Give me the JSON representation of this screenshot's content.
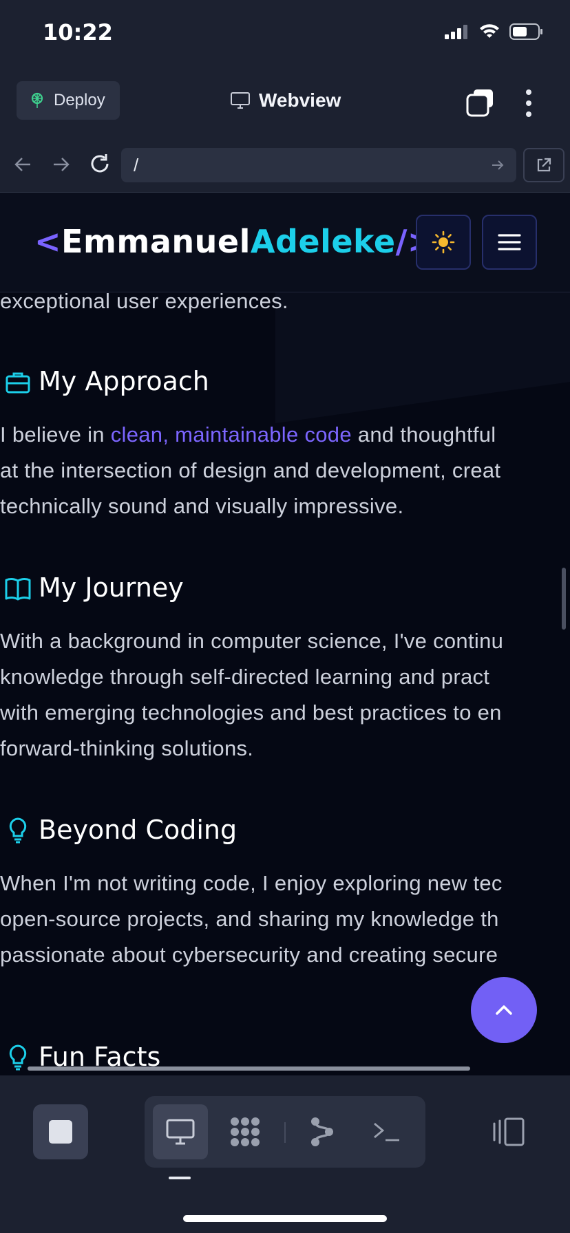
{
  "status_bar": {
    "time": "10:22"
  },
  "replit_topbar": {
    "deploy_label": "Deploy",
    "title": "Webview"
  },
  "url_bar": {
    "value": "/"
  },
  "site": {
    "logo": {
      "open": "<",
      "first_name": "Emmanuel",
      "last_name": "Adeleke",
      "close": "/>"
    }
  },
  "content": {
    "intro_tail": "exceptional user experiences.",
    "sections": [
      {
        "title": "My Approach",
        "icon": "briefcase-icon",
        "lines": [
          {
            "pre": "I believe in ",
            "hl": "clean, maintainable code",
            "post": " and thoughtful"
          },
          {
            "pre": "at the intersection of design and development, creat"
          },
          {
            "pre": "technically sound and visually impressive."
          }
        ]
      },
      {
        "title": "My Journey",
        "icon": "book-icon",
        "lines": [
          {
            "pre": "With a background in computer science, I've continu"
          },
          {
            "pre": "knowledge through self-directed learning and pract"
          },
          {
            "pre": "with emerging technologies and best practices to en"
          },
          {
            "pre": "forward-thinking solutions."
          }
        ]
      },
      {
        "title": "Beyond Coding",
        "icon": "lightbulb-icon",
        "lines": [
          {
            "pre": "When I'm not writing code, I enjoy exploring new tec"
          },
          {
            "pre": "open-source projects, and sharing my knowledge th"
          },
          {
            "pre": "passionate about cybersecurity and creating secure"
          }
        ]
      },
      {
        "title": "Fun Facts",
        "icon": "lightbulb-icon",
        "lines": []
      }
    ]
  },
  "colors": {
    "accent_purple": "#7a63ff",
    "accent_cyan": "#1ccfea",
    "sun_yellow": "#f5b82e",
    "background": "#050814"
  }
}
